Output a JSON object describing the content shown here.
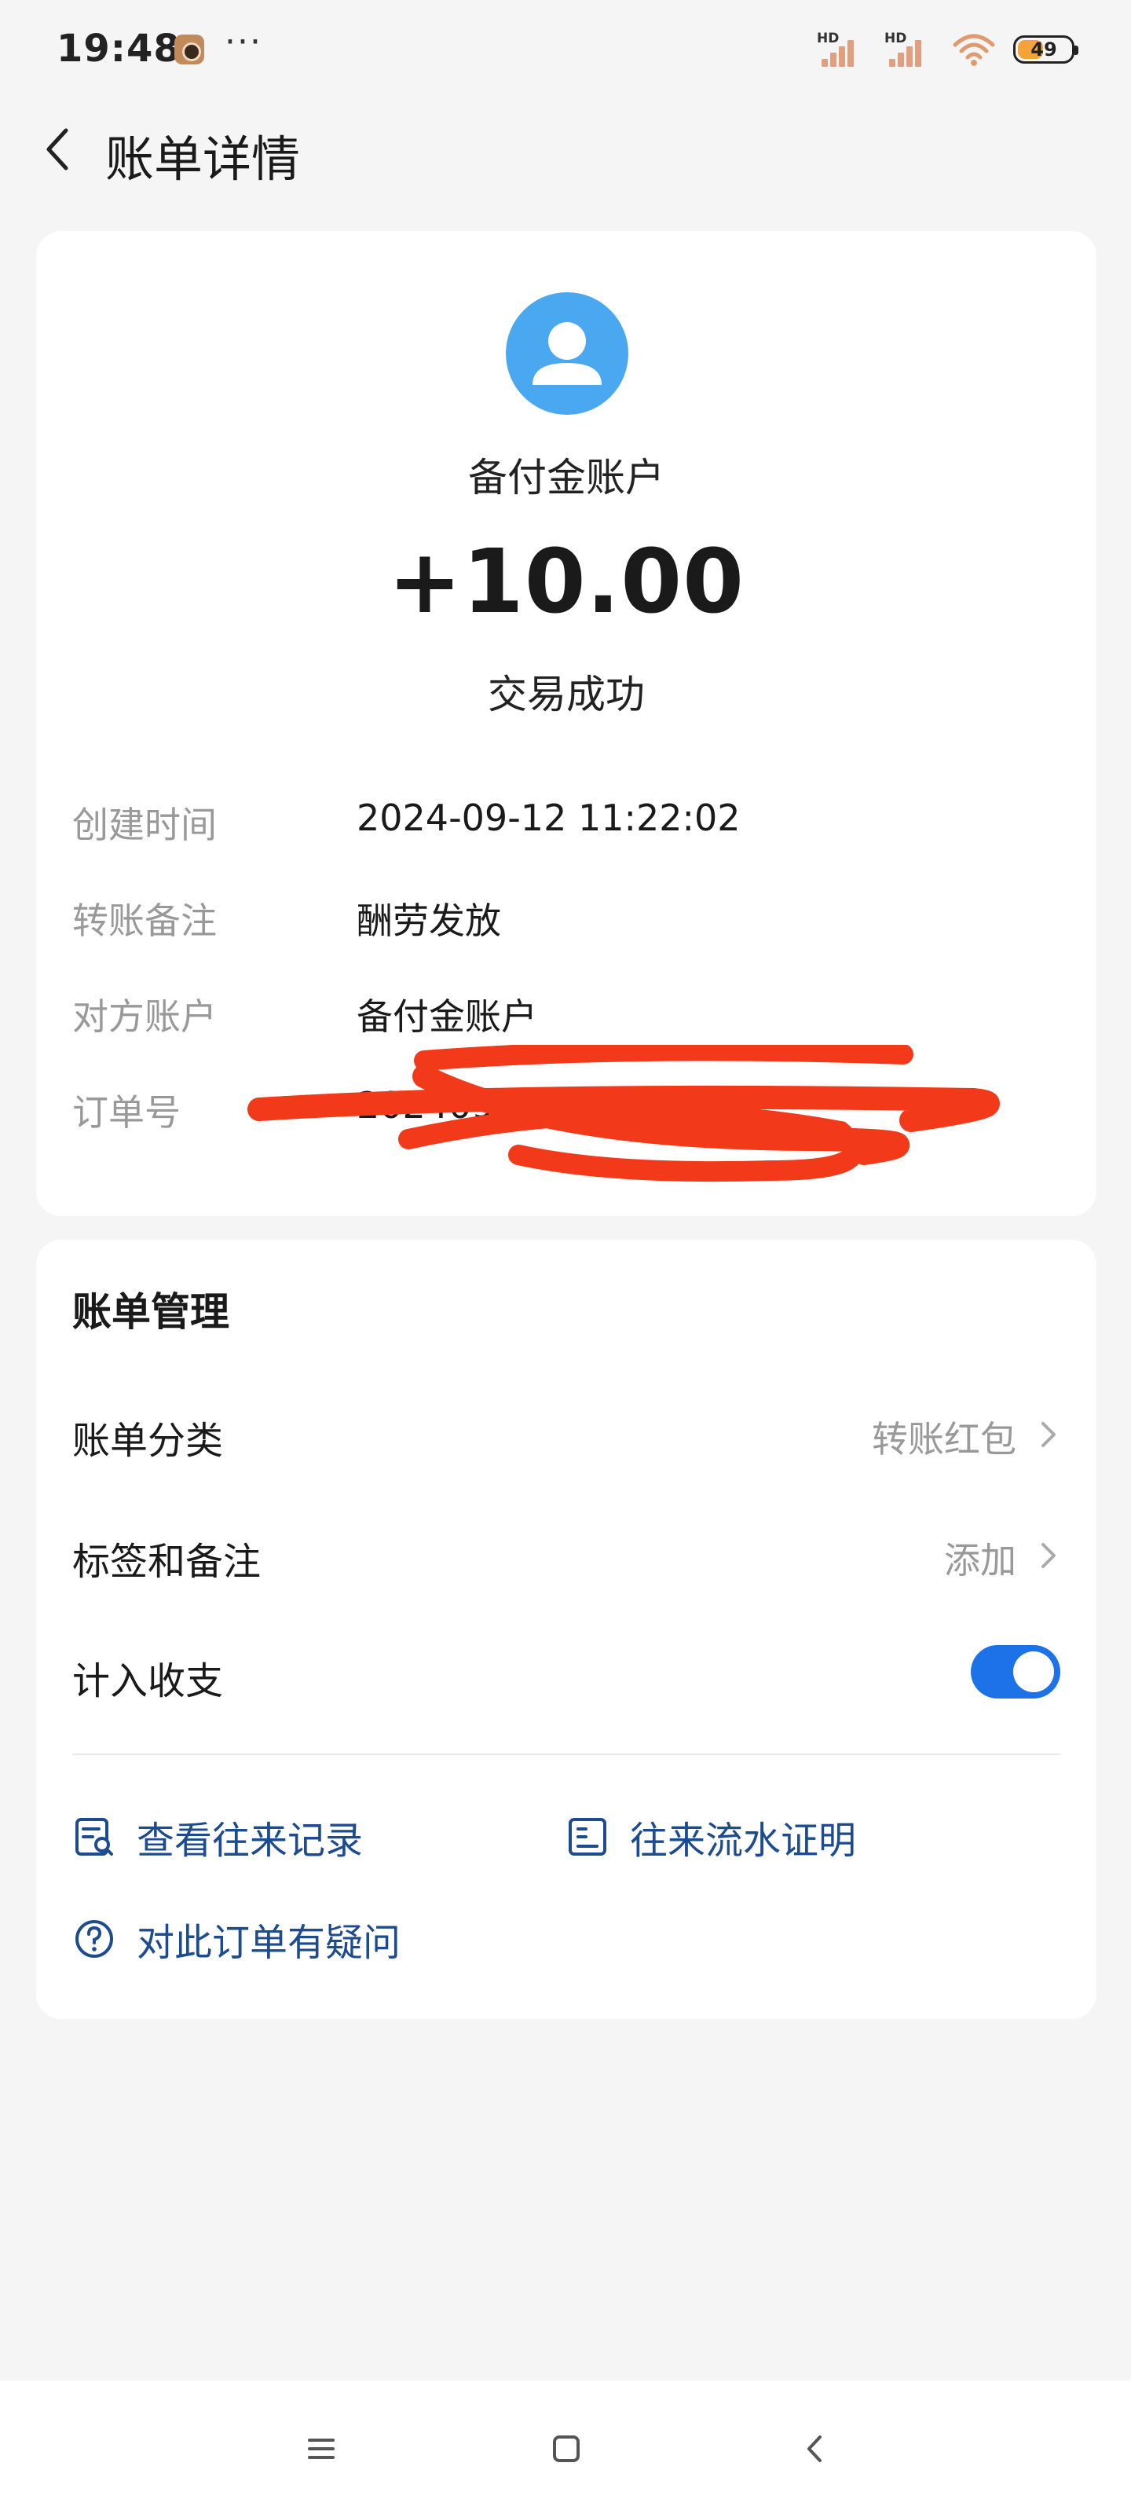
{
  "status_bar": {
    "time": "19:48",
    "dots": "···",
    "sim1_label": "HD",
    "sim2_label": "HD",
    "battery_level": "49"
  },
  "header": {
    "title": "账单详情"
  },
  "summary": {
    "account_name": "备付金账户",
    "amount": "+10.00",
    "status": "交易成功",
    "avatar_color": "#4aa8f0"
  },
  "details": [
    {
      "label": "创建时间",
      "value": "2024-09-12 11:22:02"
    },
    {
      "label": "转账备注",
      "value": "酬劳发放"
    },
    {
      "label": "对方账户",
      "value": "备付金账户"
    },
    {
      "label": "订单号",
      "value": "2024092...1660717"
    }
  ],
  "management": {
    "title": "账单管理",
    "category_label": "账单分类",
    "category_value": "转账红包",
    "tags_label": "标签和备注",
    "tags_value": "添加",
    "income_label": "计入收支",
    "income_enabled": true,
    "accent_color": "#1e72e8"
  },
  "links": {
    "history": "查看往来记录",
    "statement": "往来流水证明",
    "question": "对此订单有疑问",
    "link_color": "#1d4b8f"
  }
}
